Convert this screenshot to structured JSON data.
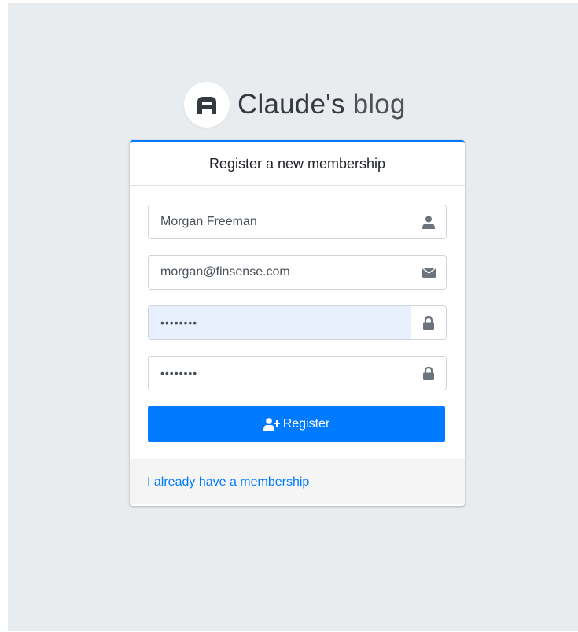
{
  "brand": {
    "name_bold": "Claude's",
    "name_light": "blog",
    "logo_icon": "brand-logo-icon"
  },
  "card": {
    "header_title": "Register a new membership",
    "accent_color": "#007bff"
  },
  "form": {
    "fullname": {
      "value": "Morgan Freeman",
      "icon": "user-icon"
    },
    "email": {
      "value": "morgan@finsense.com",
      "icon": "envelope-icon"
    },
    "password": {
      "value": "password",
      "icon": "lock-icon"
    },
    "retype_password": {
      "value": "password",
      "icon": "lock-icon"
    },
    "register_label": "Register",
    "register_icon": "user-plus-icon"
  },
  "footer": {
    "login_link": "I already have a membership"
  }
}
